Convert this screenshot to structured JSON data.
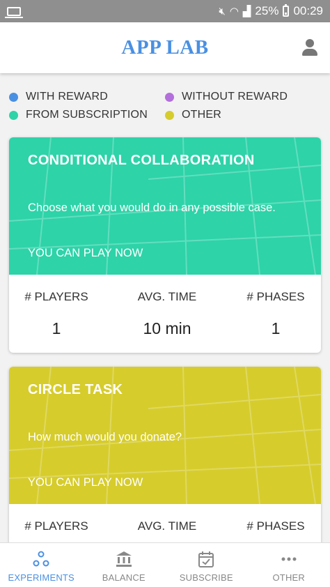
{
  "status_bar": {
    "battery": "25%",
    "time": "00:29"
  },
  "header": {
    "title": "APP LAB"
  },
  "legend": [
    {
      "label": "WITH REWARD",
      "color": "#4a90e2"
    },
    {
      "label": "WITHOUT REWARD",
      "color": "#b36fdc"
    },
    {
      "label": "FROM SUBSCRIPTION",
      "color": "#2ed3a8"
    },
    {
      "label": "OTHER",
      "color": "#d6cc2c"
    }
  ],
  "cards": [
    {
      "title": "CONDITIONAL COLLABORATION",
      "description": "Choose what you would do in any possible case.",
      "action": "YOU CAN PLAY NOW",
      "color": "#2ed3a8",
      "stats": [
        {
          "label": "# PLAYERS",
          "value": "1"
        },
        {
          "label": "AVG. TIME",
          "value": "10 min"
        },
        {
          "label": "# PHASES",
          "value": "1"
        }
      ]
    },
    {
      "title": "CIRCLE TASK",
      "description": "How much would you donate?",
      "action": "YOU CAN PLAY NOW",
      "color": "#d6cc2c",
      "stats": [
        {
          "label": "# PLAYERS",
          "value": ""
        },
        {
          "label": "AVG. TIME",
          "value": ""
        },
        {
          "label": "# PHASES",
          "value": ""
        }
      ]
    }
  ],
  "bottom_nav": [
    {
      "label": "EXPERIMENTS",
      "icon": "experiments-icon",
      "active": true
    },
    {
      "label": "BALANCE",
      "icon": "bank-icon",
      "active": false
    },
    {
      "label": "SUBSCRIBE",
      "icon": "calendar-check-icon",
      "active": false
    },
    {
      "label": "OTHER",
      "icon": "more-dots-icon",
      "active": false
    }
  ],
  "colors": {
    "accent": "#4a90e2",
    "inactive_nav": "#888888"
  }
}
